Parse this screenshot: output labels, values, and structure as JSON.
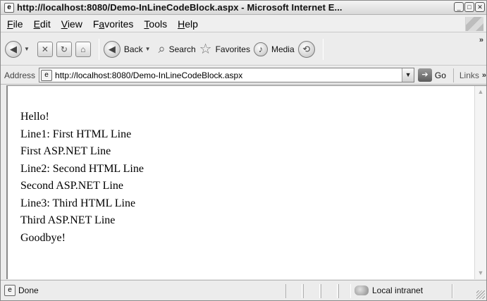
{
  "window": {
    "title": "http://localhost:8080/Demo-InLineCodeBlock.aspx - Microsoft Internet E...",
    "buttons": [
      "minimize",
      "maximize",
      "close"
    ]
  },
  "menu": [
    {
      "label": "File",
      "accel": "F",
      "rest": "ile"
    },
    {
      "label": "Edit",
      "accel": "E",
      "rest": "dit"
    },
    {
      "label": "View",
      "accel": "V",
      "rest": "iew"
    },
    {
      "label": "Favorites",
      "pre": "F",
      "accel": "a",
      "rest": "vorites"
    },
    {
      "label": "Tools",
      "accel": "T",
      "rest": "ools"
    },
    {
      "label": "Help",
      "accel": "H",
      "rest": "elp"
    }
  ],
  "toolbar": {
    "back_label": "Back",
    "search_label": "Search",
    "favorites_label": "Favorites",
    "media_label": "Media",
    "more": "»"
  },
  "address": {
    "label": "Address",
    "url": "http://localhost:8080/Demo-InLineCodeBlock.aspx",
    "go_label": "Go",
    "links_label": "Links",
    "links_more": "»"
  },
  "page": {
    "lines": [
      "Hello!",
      "Line1: First HTML Line",
      "First ASP.NET Line",
      "Line2: Second HTML Line",
      "Second ASP.NET Line",
      "Line3: Third HTML Line",
      "Third ASP.NET Line",
      "Goodbye!"
    ]
  },
  "status": {
    "text": "Done",
    "zone": "Local intranet"
  },
  "icons": {
    "page": "page-icon",
    "back": "back-arrow-icon",
    "forward": "forward-arrow-icon",
    "stop": "stop-icon",
    "refresh": "refresh-icon",
    "home": "home-icon",
    "search": "search-icon",
    "favorites": "star-icon",
    "media": "media-icon",
    "history": "history-icon"
  }
}
